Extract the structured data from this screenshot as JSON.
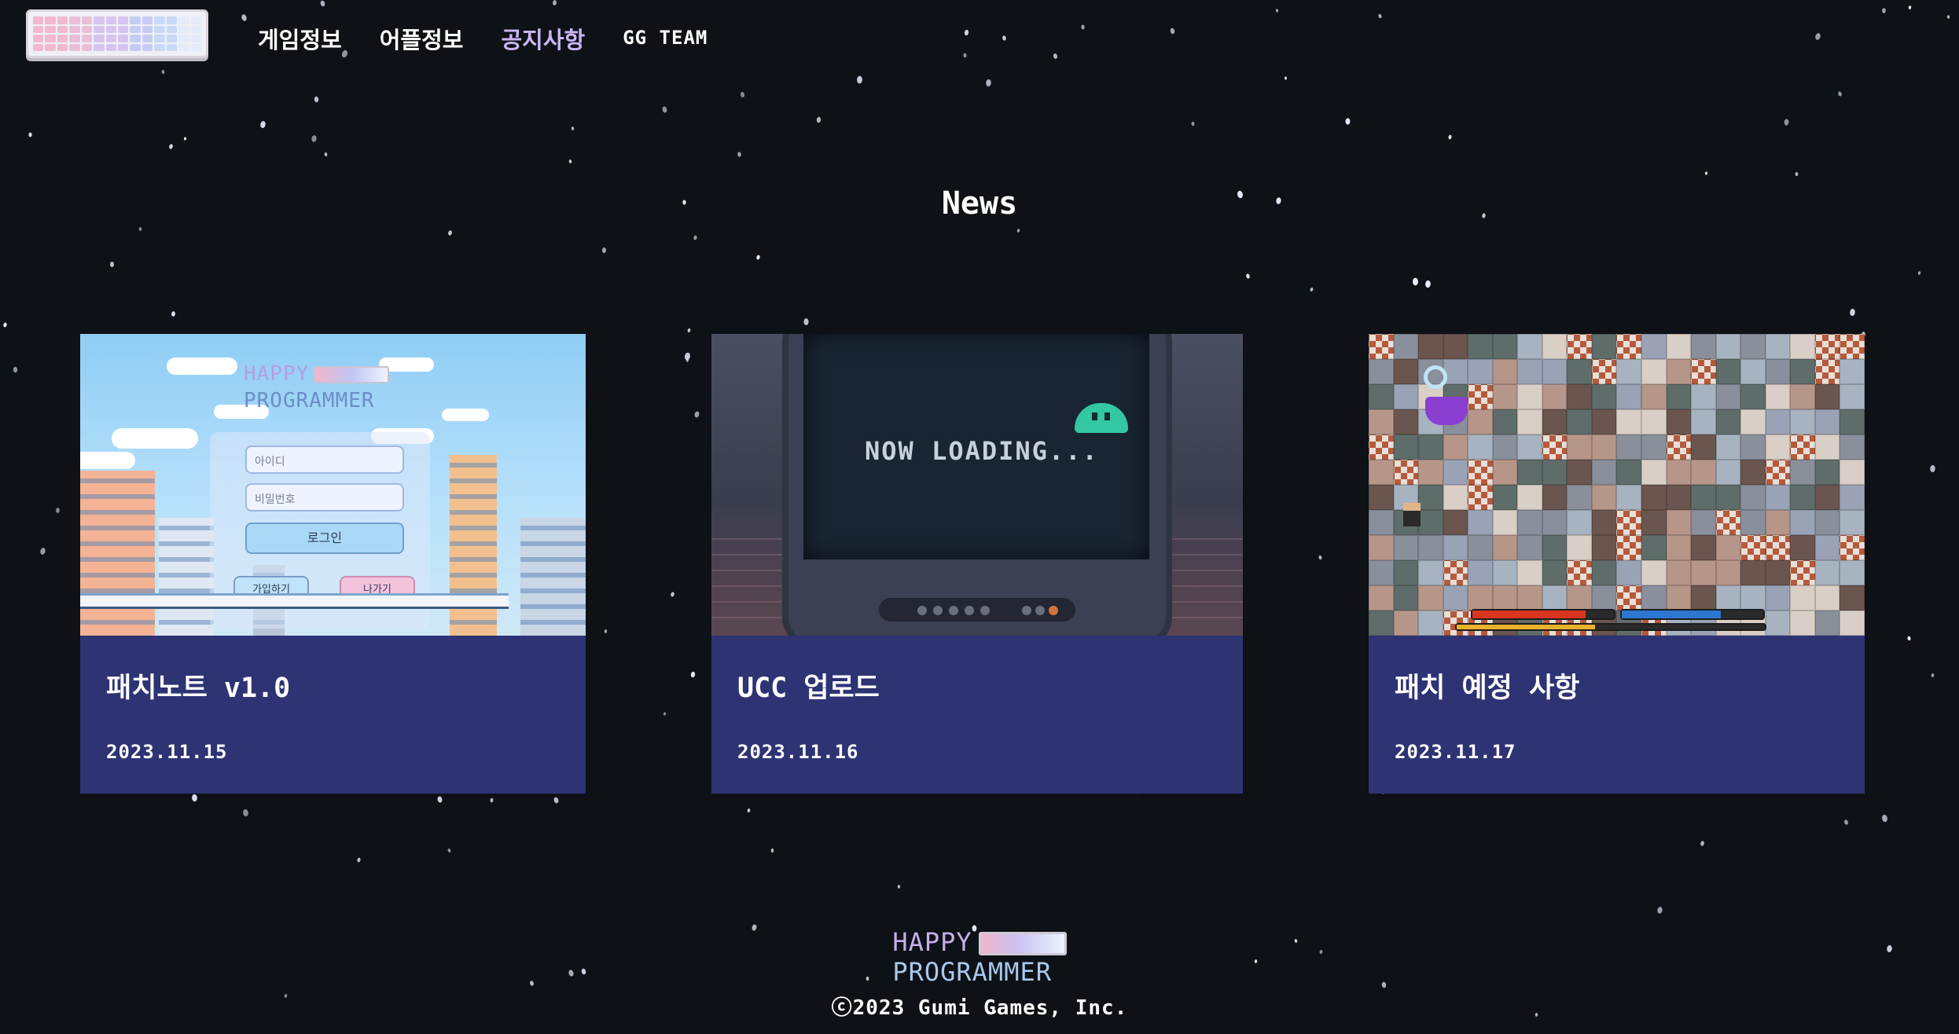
{
  "header": {
    "nav": [
      {
        "label": "게임정보",
        "active": false
      },
      {
        "label": "어플정보",
        "active": false
      },
      {
        "label": "공지사항",
        "active": true
      },
      {
        "label": "GG TEAM",
        "active": false
      }
    ]
  },
  "section": {
    "title": "News"
  },
  "cards": [
    {
      "title": "패치노트 v1.0",
      "date": "2023.11.15",
      "thumbnail": {
        "logo_line1": "HAPPY",
        "logo_line2": "PROGRAMMER",
        "id_placeholder": "아이디",
        "pw_placeholder": "비밀번호",
        "login_label": "로그인",
        "join_label": "가입하기",
        "exit_label": "나가기"
      }
    },
    {
      "title": "UCC 업로드",
      "date": "2023.11.16",
      "thumbnail": {
        "screen_text": "NOW LOADING..."
      }
    },
    {
      "title": "패치 예정 사항",
      "date": "2023.11.17",
      "thumbnail": {
        "hp_fraction": 0.8,
        "mp_fraction": 0.7,
        "xp_fraction": 0.45
      }
    }
  ],
  "footer": {
    "logo_line1": "HAPPY",
    "logo_line2": "PROGRAMMER",
    "copyright": "ⓒ2023 Gumi Games, Inc."
  },
  "colors": {
    "background": "#0e1116",
    "card": "#2e3374",
    "nav_active": "#c9b6f2"
  }
}
